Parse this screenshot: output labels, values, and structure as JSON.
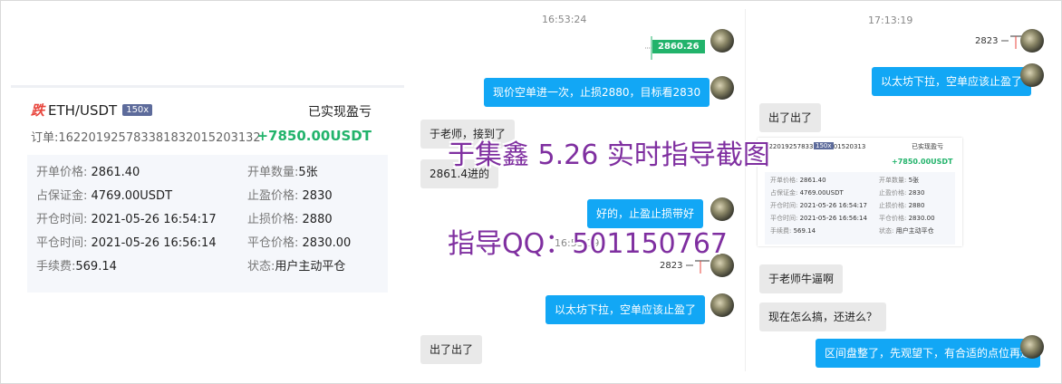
{
  "order": {
    "direction": "跌",
    "symbol": "ETH/USDT",
    "leverage": "150x",
    "pnl_title": "已实现盈亏",
    "order_no": "订单:1622019257833818320152031 32",
    "order_no_display": "订单:162201925783381832015203132",
    "pnl": "+7850.00USDT",
    "fields": {
      "open_price_k": "开单价格:",
      "open_price_v": "2861.40",
      "open_qty_k": "开单数量:",
      "open_qty_v": "5张",
      "margin_k": "占保证金:",
      "margin_v": "4769.00USDT",
      "tp_k": "止盈价格:",
      "tp_v": "2830",
      "open_time_k": "开仓时间:",
      "open_time_v": "2021-05-26 16:54:17",
      "sl_k": "止损价格:",
      "sl_v": "2880",
      "close_time_k": "平仓时间:",
      "close_time_v": "2021-05-26 16:56:14",
      "close_price_k": "平仓价格:",
      "close_price_v": "2830.00",
      "fee_k": "手续费:",
      "fee_v": "569.14",
      "status_k": "状态:",
      "status_v": "用户主动平仓"
    }
  },
  "chat_left": {
    "time1": "16:53:24",
    "price_tag": "2860.26",
    "msg_out_1": "现价空单进一次，止损2880，目标看2830",
    "msg_in_1": "于老师，接到了",
    "msg_in_2": "2861.4进的",
    "msg_out_2": "好的，止盈止损带好",
    "time2": "16:53:19",
    "mini_price": "2823",
    "msg_out_3": "以太坊下拉，空单应该止盈了",
    "msg_in_3": "出了出了"
  },
  "chat_right": {
    "time1": "17:13:19",
    "mini_price": "2823",
    "msg_out_1": "以太坊下拉，空单应该止盈了",
    "msg_in_1": "出了出了",
    "msg_in_2": "于老师牛逼啊",
    "msg_in_3": "现在怎么搞，还进么？",
    "msg_out_2": "区间盘整了，先观望下，有合适的点位再进"
  },
  "mini_card": {
    "order_no": "6220192578338183201520313",
    "leverage": "150x",
    "pnl_title": "已实现盈亏",
    "pnl": "+7850.00USDT",
    "l1k": "开单价格:",
    "l1v": "2861.40",
    "r1k": "开单数量:",
    "r1v": "5张",
    "l2k": "占保证金:",
    "l2v": "4769.00USDT",
    "r2k": "止盈价格:",
    "r2v": "2830",
    "l3k": "开仓时间:",
    "l3v": "2021-05-26 16:54:17",
    "r3k": "止损价格:",
    "r3v": "2880",
    "l4k": "平仓时间:",
    "l4v": "2021-05-26 16:56:14",
    "r4k": "平仓价格:",
    "r4v": "2830.00",
    "l5k": "手续费:",
    "l5v": "569.14",
    "r5k": "状态:",
    "r5v": "用户主动平仓"
  },
  "watermark": {
    "line1": "于集鑫 5.26 实时指导截图",
    "line2": "指导QQ：501150767"
  },
  "colors": {
    "accent_blue": "#12a7f5",
    "profit_green": "#22b36b",
    "loss_red": "#e8453c",
    "watermark": "#7f2fa0"
  }
}
